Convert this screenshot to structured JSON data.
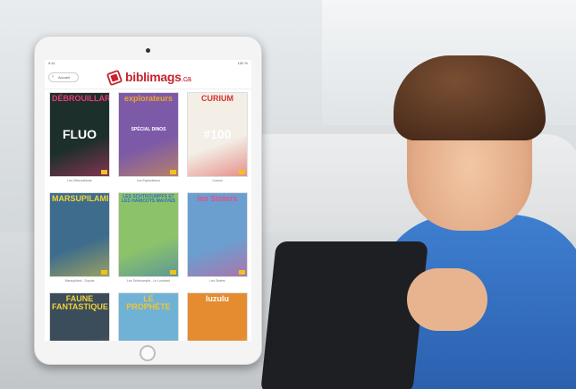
{
  "app": {
    "brand": "biblimags",
    "brand_tld": ".ca",
    "back_label": "Accueil"
  },
  "status": {
    "time": "9:41",
    "battery": "100 %"
  },
  "magazines": [
    {
      "title": "DÉBROUILLARDS",
      "subtitle": "FLUO",
      "caption": "Les Débrouillards",
      "bg": "#1d2f2a",
      "accent": "#e63b7a"
    },
    {
      "title": "explorateurs",
      "subtitle": "SPÉCIAL DINOS",
      "caption": "Les Explorateurs",
      "bg": "#7c5aa8",
      "accent": "#f0a52a"
    },
    {
      "title": "CURIUM",
      "subtitle": "#100",
      "caption": "Curium",
      "bg": "#f3eee6",
      "accent": "#d8322f"
    },
    {
      "title": "MARSUPILAMI",
      "subtitle": "",
      "caption": "Marsupilami - Dupuis",
      "bg": "#3e6c8c",
      "accent": "#f3d43a"
    },
    {
      "title": "LES SCHTROUMPFS ET LES HARICOTS MAUVES",
      "subtitle": "",
      "caption": "Les Schtroumpfs - Le Lombard",
      "bg": "#8cc36a",
      "accent": "#2f6fbf"
    },
    {
      "title": "les Sisters",
      "subtitle": "",
      "caption": "Les Sisters",
      "bg": "#6a9fd0",
      "accent": "#e84d8a"
    },
    {
      "title": "FAUNE FANTASTIQUE",
      "subtitle": "",
      "caption": "",
      "bg": "#3b4c5a",
      "accent": "#f1d23c"
    },
    {
      "title": "LE PROPHÈTE",
      "subtitle": "",
      "caption": "",
      "bg": "#6fb2d6",
      "accent": "#f4c430"
    },
    {
      "title": "luzulu",
      "subtitle": "",
      "caption": "",
      "bg": "#e48c2f",
      "accent": "#ffffff"
    }
  ],
  "colors": {
    "brand_red": "#c62430"
  }
}
